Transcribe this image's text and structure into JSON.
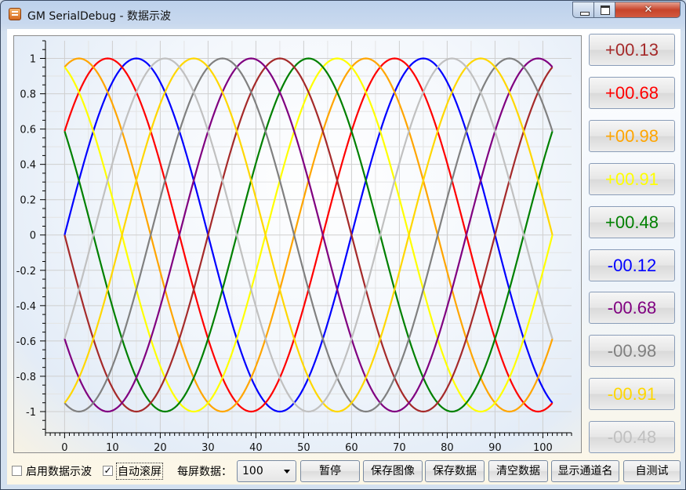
{
  "window": {
    "title": "GM SerialDebug - 数据示波"
  },
  "chart_data": {
    "type": "line",
    "title": "",
    "xlabel": "",
    "ylabel": "",
    "xlim": [
      -4,
      106
    ],
    "ylim": [
      -1.12,
      1.1
    ],
    "xticks": [
      0,
      10,
      20,
      30,
      40,
      50,
      60,
      70,
      80,
      90,
      100
    ],
    "xtick_labels": [
      "0",
      "10",
      "20",
      "30",
      "40",
      "50",
      "60",
      "70",
      "80",
      "90",
      "100"
    ],
    "yticks": [
      1,
      0.8,
      0.6,
      0.4,
      0.2,
      0,
      -0.2,
      -0.4,
      -0.6,
      -0.8,
      -1
    ],
    "ytick_labels": [
      "1",
      "0.8",
      "0.6",
      "0.4",
      "0.2",
      "0",
      "-0.2",
      "-0.4",
      "-0.6",
      "-0.8",
      "-1"
    ],
    "grid": true,
    "x_range": [
      0,
      102
    ],
    "series": [
      {
        "color": "#0000ff",
        "phase_deg": 0,
        "period": 60,
        "amplitude": 1
      },
      {
        "color": "#ff0000",
        "phase_deg": 36,
        "period": 60,
        "amplitude": 1
      },
      {
        "color": "#ffa500",
        "phase_deg": 72,
        "period": 60,
        "amplitude": 1
      },
      {
        "color": "#ffff00",
        "phase_deg": 108,
        "period": 60,
        "amplitude": 1
      },
      {
        "color": "#008000",
        "phase_deg": 144,
        "period": 60,
        "amplitude": 1
      },
      {
        "color": "#a52a2a",
        "phase_deg": 180,
        "period": 60,
        "amplitude": 1
      },
      {
        "color": "#800080",
        "phase_deg": 216,
        "period": 60,
        "amplitude": 1
      },
      {
        "color": "#808080",
        "phase_deg": 252,
        "period": 60,
        "amplitude": 1
      },
      {
        "color": "#ffd700",
        "phase_deg": 288,
        "period": 60,
        "amplitude": 1
      },
      {
        "color": "#c0c0c0",
        "phase_deg": 324,
        "period": 60,
        "amplitude": 1
      }
    ]
  },
  "channel_values": [
    {
      "label": "+00.13",
      "color": "#a52a2a"
    },
    {
      "label": "+00.68",
      "color": "#ff0000"
    },
    {
      "label": "+00.98",
      "color": "#ffa500"
    },
    {
      "label": "+00.91",
      "color": "#ffff00"
    },
    {
      "label": "+00.48",
      "color": "#008000"
    },
    {
      "label": "-00.12",
      "color": "#0000ff"
    },
    {
      "label": "-00.68",
      "color": "#800080"
    },
    {
      "label": "-00.98",
      "color": "#808080"
    },
    {
      "label": "-00.91",
      "color": "#ffd700"
    },
    {
      "label": "-00.48",
      "color": "#c0c0c0"
    }
  ],
  "controls": {
    "enable_wave_label": "启用数据示波",
    "enable_wave_checked": false,
    "auto_scroll_label": "自动滚屏",
    "auto_scroll_checked": true,
    "per_screen_label": "每屏数据：",
    "per_screen_value": "100",
    "pause_label": "暂停",
    "save_image_label": "保存图像",
    "save_data_label": "保存数据",
    "clear_data_label": "清空数据",
    "show_channel_names_label": "显示通道名",
    "self_test_label": "自测试"
  }
}
